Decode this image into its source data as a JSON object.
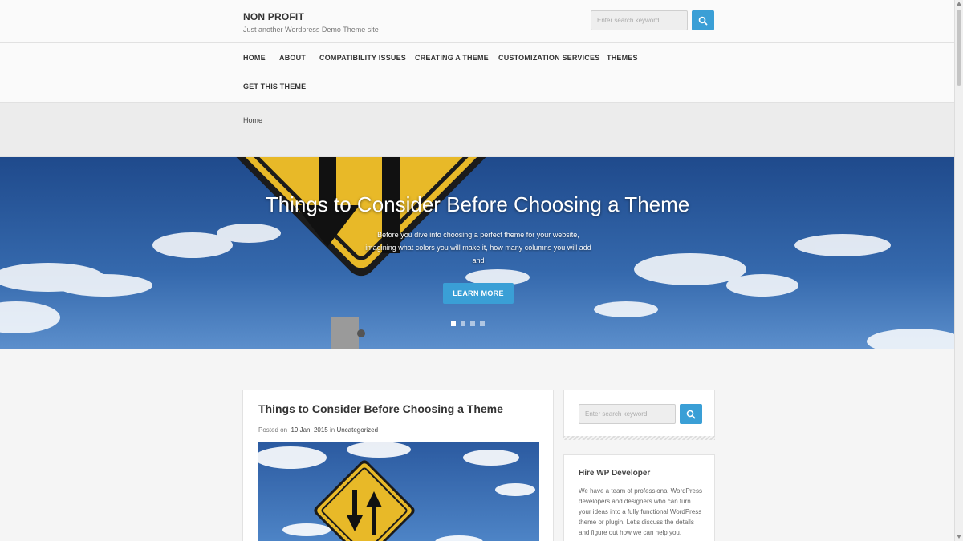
{
  "header": {
    "site_title": "NON PROFIT",
    "site_description": "Just another Wordpress Demo Theme site",
    "search": {
      "placeholder": "Enter search keyword",
      "icon": "search-icon"
    }
  },
  "nav": {
    "items": [
      {
        "label": "HOME"
      },
      {
        "label": "ABOUT"
      },
      {
        "label": "COMPATIBILITY ISSUES"
      },
      {
        "label": "CREATING A THEME"
      },
      {
        "label": "CUSTOMIZATION SERVICES"
      },
      {
        "label": "THEMES"
      },
      {
        "label": "GET THIS THEME"
      }
    ]
  },
  "breadcrumb": {
    "current": "Home"
  },
  "hero": {
    "title": "Things to Consider Before Choosing a Theme",
    "excerpt": "Before you dive into choosing a perfect theme for your website, imagining what colors you will make it, how many columns you will add and",
    "button_label": "LEARN MORE",
    "slide_count": 4,
    "active_slide": 1
  },
  "post": {
    "title": "Things to Consider Before Choosing a Theme",
    "meta_prefix": "Posted on",
    "date": "19 Jan, 2015",
    "meta_in": "in",
    "category": "Uncategorized"
  },
  "sidebar": {
    "search": {
      "placeholder": "Enter search keyword",
      "icon": "search-icon"
    },
    "hire": {
      "title": "Hire WP Developer",
      "text": "We have a team of professional WordPress developers and designers who can turn your ideas into a fully functional WordPress theme or plugin. Let's discuss the details and figure out how we can help you."
    }
  },
  "colors": {
    "accent": "#3a9fd6",
    "sky": "#2f5fa3",
    "sign_yellow": "#e8b928"
  }
}
